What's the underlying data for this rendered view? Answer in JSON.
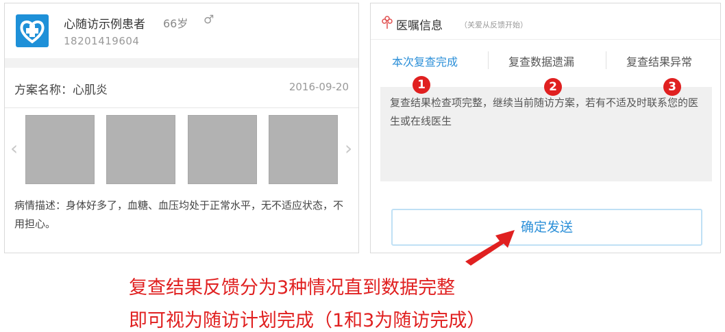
{
  "patient": {
    "name": "心随访示例患者",
    "age": "66岁",
    "gender_symbol": "♂",
    "phone": "18201419604"
  },
  "plan": {
    "label": "方案名称：心肌炎",
    "date": "2016-09-20",
    "thumbnail_count": 4,
    "description": "病情描述：身体好多了，血糖、血压均处于正常水平，无不适应状态，不用担心。"
  },
  "advice": {
    "title": "医嘱信息",
    "subtitle": "（关爱从反馈开始）",
    "options": [
      "本次复查完成",
      "复查数据遗漏",
      "复查结果异常"
    ],
    "selected_option": 0,
    "message": "复查结果检查项完整，继续当前随访方案，若有不适及时联系您的医生或在线医生",
    "confirm_label": "确定发送"
  },
  "badges": [
    "1",
    "2",
    "3"
  ],
  "caption": {
    "line1": "复查结果反馈分为3种情况直到数据完整",
    "line2": "即可视为随访计划完成（1和3为随访完成）"
  },
  "colors": {
    "accent": "#2b8fd8",
    "icon_bg": "#1e90d8",
    "annotation_red": "#e02020",
    "placeholder_gray": "#b2b2b2"
  }
}
